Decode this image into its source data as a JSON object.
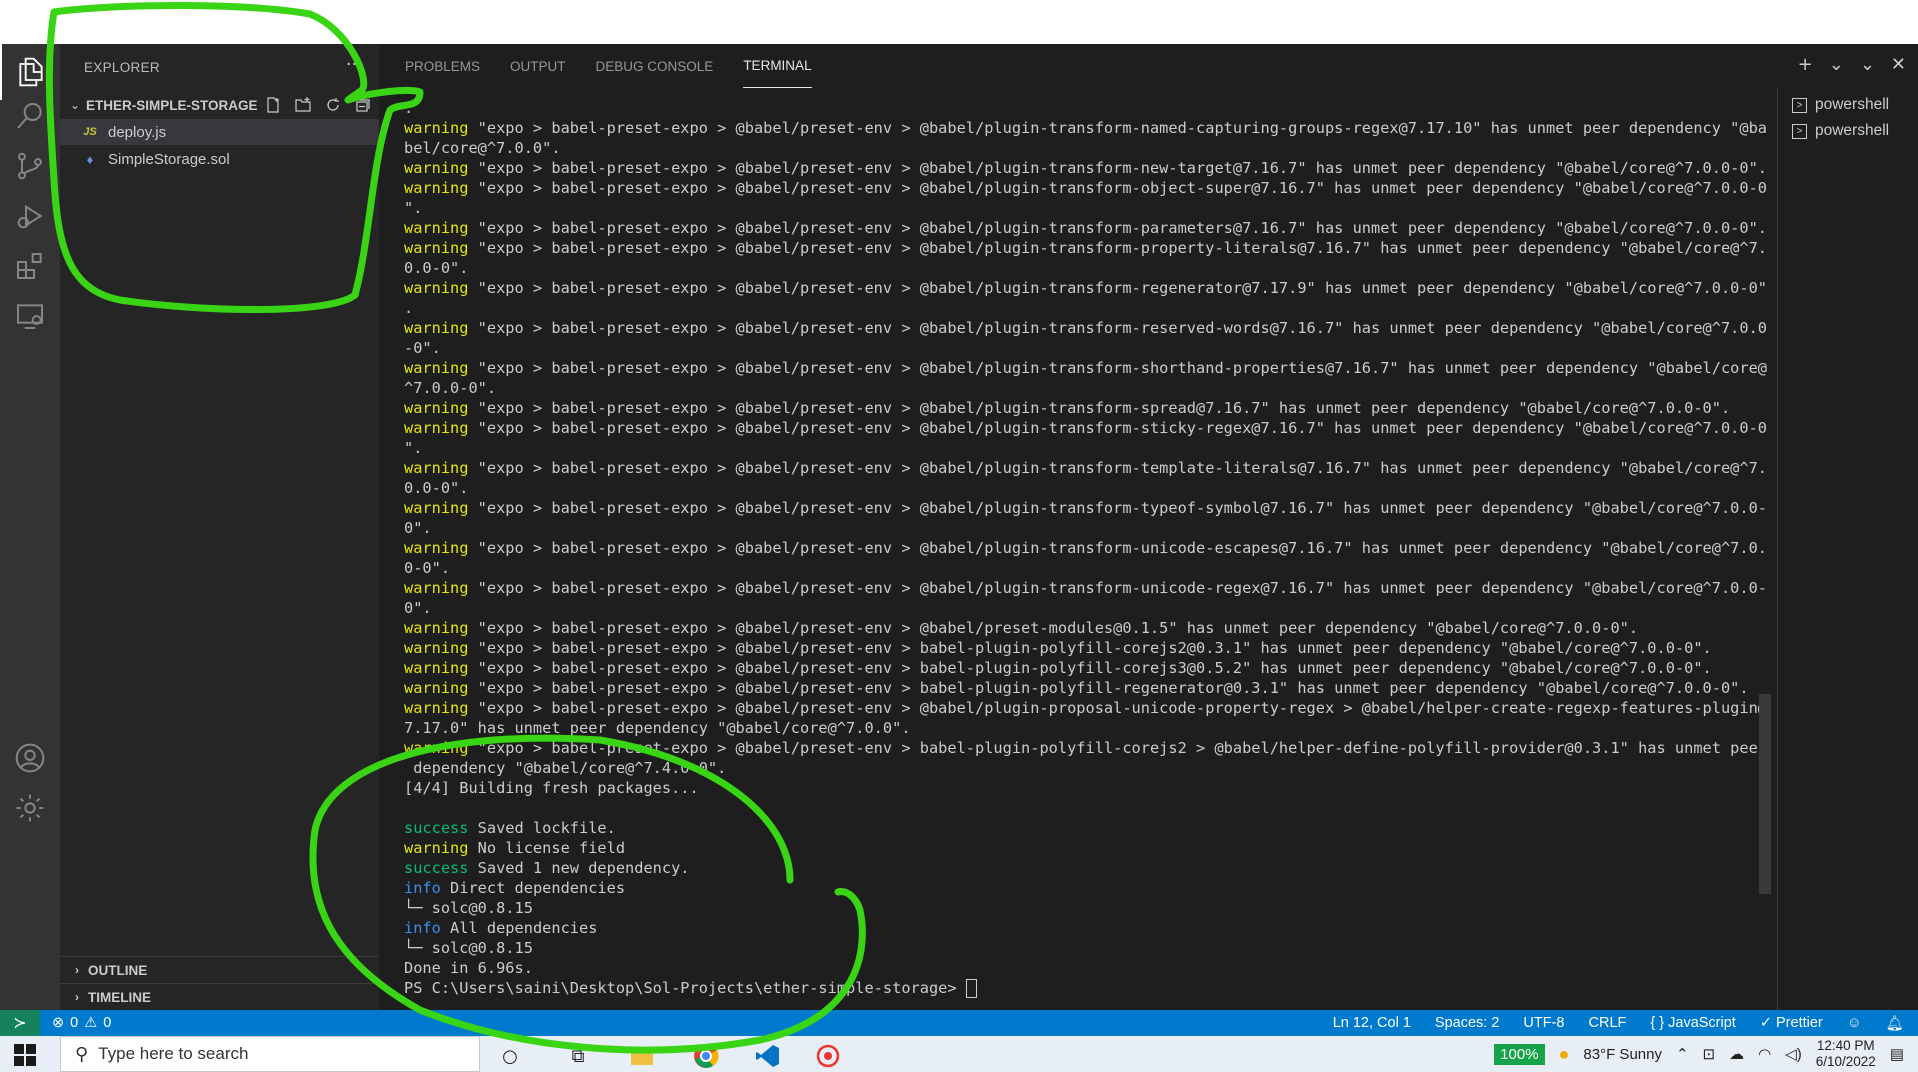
{
  "explorer": {
    "title": "EXPLORER",
    "more": "···",
    "folder": "ETHER-SIMPLE-STORAGE",
    "files": [
      {
        "icon": "JS",
        "name": "deploy.js",
        "selected": true
      },
      {
        "icon": "♦",
        "name": "SimpleStorage.sol",
        "selected": false
      }
    ],
    "outline": "OUTLINE",
    "timeline": "TIMELINE"
  },
  "panel": {
    "tabs": [
      "PROBLEMS",
      "OUTPUT",
      "DEBUG CONSOLE",
      "TERMINAL"
    ],
    "active_tab": "TERMINAL",
    "terminals": [
      "powershell",
      "powershell"
    ]
  },
  "terminal_lines": [
    {
      "p": "",
      "t": "."
    },
    {
      "p": "warning",
      "t": " \"expo > babel-preset-expo > @babel/preset-env > @babel/plugin-transform-named-capturing-groups-regex@7.17.10\" has unmet peer dependency \"@ba"
    },
    {
      "p": "",
      "t": "bel/core@^7.0.0\"."
    },
    {
      "p": "warning",
      "t": " \"expo > babel-preset-expo > @babel/preset-env > @babel/plugin-transform-new-target@7.16.7\" has unmet peer dependency \"@babel/core@^7.0.0-0\"."
    },
    {
      "p": "warning",
      "t": " \"expo > babel-preset-expo > @babel/preset-env > @babel/plugin-transform-object-super@7.16.7\" has unmet peer dependency \"@babel/core@^7.0.0-0"
    },
    {
      "p": "",
      "t": "\"."
    },
    {
      "p": "warning",
      "t": " \"expo > babel-preset-expo > @babel/preset-env > @babel/plugin-transform-parameters@7.16.7\" has unmet peer dependency \"@babel/core@^7.0.0-0\"."
    },
    {
      "p": "warning",
      "t": " \"expo > babel-preset-expo > @babel/preset-env > @babel/plugin-transform-property-literals@7.16.7\" has unmet peer dependency \"@babel/core@^7."
    },
    {
      "p": "",
      "t": "0.0-0\"."
    },
    {
      "p": "warning",
      "t": " \"expo > babel-preset-expo > @babel/preset-env > @babel/plugin-transform-regenerator@7.17.9\" has unmet peer dependency \"@babel/core@^7.0.0-0\""
    },
    {
      "p": "",
      "t": "."
    },
    {
      "p": "warning",
      "t": " \"expo > babel-preset-expo > @babel/preset-env > @babel/plugin-transform-reserved-words@7.16.7\" has unmet peer dependency \"@babel/core@^7.0.0"
    },
    {
      "p": "",
      "t": "-0\"."
    },
    {
      "p": "warning",
      "t": " \"expo > babel-preset-expo > @babel/preset-env > @babel/plugin-transform-shorthand-properties@7.16.7\" has unmet peer dependency \"@babel/core@"
    },
    {
      "p": "",
      "t": "^7.0.0-0\"."
    },
    {
      "p": "warning",
      "t": " \"expo > babel-preset-expo > @babel/preset-env > @babel/plugin-transform-spread@7.16.7\" has unmet peer dependency \"@babel/core@^7.0.0-0\"."
    },
    {
      "p": "warning",
      "t": " \"expo > babel-preset-expo > @babel/preset-env > @babel/plugin-transform-sticky-regex@7.16.7\" has unmet peer dependency \"@babel/core@^7.0.0-0"
    },
    {
      "p": "",
      "t": "\"."
    },
    {
      "p": "warning",
      "t": " \"expo > babel-preset-expo > @babel/preset-env > @babel/plugin-transform-template-literals@7.16.7\" has unmet peer dependency \"@babel/core@^7."
    },
    {
      "p": "",
      "t": "0.0-0\"."
    },
    {
      "p": "warning",
      "t": " \"expo > babel-preset-expo > @babel/preset-env > @babel/plugin-transform-typeof-symbol@7.16.7\" has unmet peer dependency \"@babel/core@^7.0.0-"
    },
    {
      "p": "",
      "t": "0\"."
    },
    {
      "p": "warning",
      "t": " \"expo > babel-preset-expo > @babel/preset-env > @babel/plugin-transform-unicode-escapes@7.16.7\" has unmet peer dependency \"@babel/core@^7.0."
    },
    {
      "p": "",
      "t": "0-0\"."
    },
    {
      "p": "warning",
      "t": " \"expo > babel-preset-expo > @babel/preset-env > @babel/plugin-transform-unicode-regex@7.16.7\" has unmet peer dependency \"@babel/core@^7.0.0-"
    },
    {
      "p": "",
      "t": "0\"."
    },
    {
      "p": "warning",
      "t": " \"expo > babel-preset-expo > @babel/preset-env > @babel/preset-modules@0.1.5\" has unmet peer dependency \"@babel/core@^7.0.0-0\"."
    },
    {
      "p": "warning",
      "t": " \"expo > babel-preset-expo > @babel/preset-env > babel-plugin-polyfill-corejs2@0.3.1\" has unmet peer dependency \"@babel/core@^7.0.0-0\"."
    },
    {
      "p": "warning",
      "t": " \"expo > babel-preset-expo > @babel/preset-env > babel-plugin-polyfill-corejs3@0.5.2\" has unmet peer dependency \"@babel/core@^7.0.0-0\"."
    },
    {
      "p": "warning",
      "t": " \"expo > babel-preset-expo > @babel/preset-env > babel-plugin-polyfill-regenerator@0.3.1\" has unmet peer dependency \"@babel/core@^7.0.0-0\"."
    },
    {
      "p": "warning",
      "t": " \"expo > babel-preset-expo > @babel/preset-env > @babel/plugin-proposal-unicode-property-regex > @babel/helper-create-regexp-features-plugin@"
    },
    {
      "p": "",
      "t": "7.17.0\" has unmet peer dependency \"@babel/core@^7.0.0\"."
    },
    {
      "p": "warning",
      "t": " \"expo > babel-preset-expo > @babel/preset-env > babel-plugin-polyfill-corejs2 > @babel/helper-define-polyfill-provider@0.3.1\" has unmet peer"
    },
    {
      "p": "",
      "t": " dependency \"@babel/core@^7.4.0-0\"."
    },
    {
      "p": "",
      "t": "[4/4] Building fresh packages..."
    },
    {
      "p": "",
      "t": ""
    },
    {
      "p": "success",
      "t": " Saved lockfile."
    },
    {
      "p": "warning",
      "t": " No license field"
    },
    {
      "p": "success",
      "t": " Saved 1 new dependency."
    },
    {
      "p": "info",
      "t": " Direct dependencies"
    },
    {
      "p": "",
      "t": "└─ solc@0.8.15"
    },
    {
      "p": "info",
      "t": " All dependencies"
    },
    {
      "p": "",
      "t": "└─ solc@0.8.15"
    },
    {
      "p": "",
      "t": "Done in 6.96s."
    },
    {
      "p": "",
      "t": "PS C:\\Users\\saini\\Desktop\\Sol-Projects\\ether-simple-storage> "
    }
  ],
  "statusbar": {
    "errors": "0",
    "warnings": "0",
    "position": "Ln 12, Col 1",
    "spaces": "Spaces: 2",
    "encoding": "UTF-8",
    "eol": "CRLF",
    "language": "JavaScript",
    "formatter": "Prettier"
  },
  "taskbar": {
    "search_placeholder": "Type here to search",
    "battery": "100%",
    "weather": "83°F  Sunny",
    "time": "12:40 PM",
    "date": "6/10/2022"
  },
  "colors": {
    "annotation": "#39d515",
    "accent": "#007acc",
    "warning": "#e5e510",
    "success": "#0dbc79",
    "info": "#3b8eea"
  }
}
